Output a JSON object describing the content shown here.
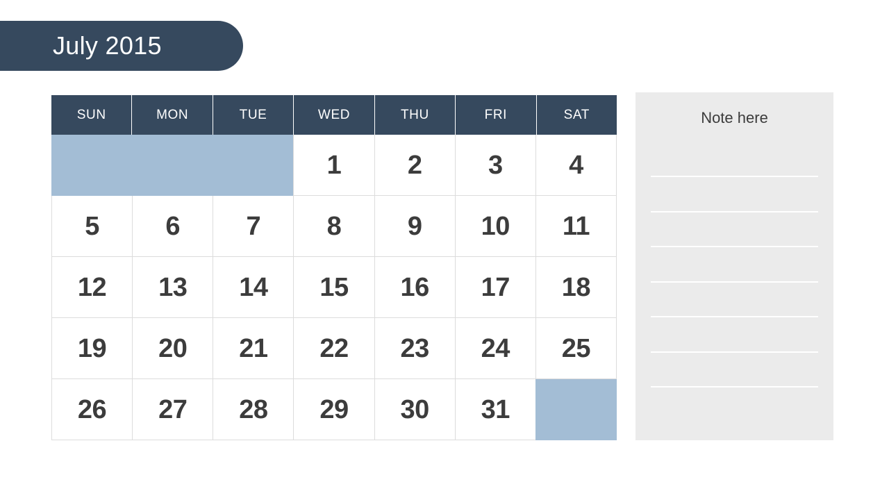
{
  "header": {
    "title": "July 2015"
  },
  "calendar": {
    "weekday_headers": [
      "SUN",
      "MON",
      "TUE",
      "WED",
      "THU",
      "FRI",
      "SAT"
    ],
    "weeks": [
      [
        {
          "label": "",
          "blank": true
        },
        {
          "label": "",
          "blank": true
        },
        {
          "label": "",
          "blank": true
        },
        {
          "label": "1",
          "blank": false
        },
        {
          "label": "2",
          "blank": false
        },
        {
          "label": "3",
          "blank": false
        },
        {
          "label": "4",
          "blank": false
        }
      ],
      [
        {
          "label": "5",
          "blank": false
        },
        {
          "label": "6",
          "blank": false
        },
        {
          "label": "7",
          "blank": false
        },
        {
          "label": "8",
          "blank": false
        },
        {
          "label": "9",
          "blank": false
        },
        {
          "label": "10",
          "blank": false
        },
        {
          "label": "11",
          "blank": false
        }
      ],
      [
        {
          "label": "12",
          "blank": false
        },
        {
          "label": "13",
          "blank": false
        },
        {
          "label": "14",
          "blank": false
        },
        {
          "label": "15",
          "blank": false
        },
        {
          "label": "16",
          "blank": false
        },
        {
          "label": "17",
          "blank": false
        },
        {
          "label": "18",
          "blank": false
        }
      ],
      [
        {
          "label": "19",
          "blank": false
        },
        {
          "label": "20",
          "blank": false
        },
        {
          "label": "21",
          "blank": false
        },
        {
          "label": "22",
          "blank": false
        },
        {
          "label": "23",
          "blank": false
        },
        {
          "label": "24",
          "blank": false
        },
        {
          "label": "25",
          "blank": false
        }
      ],
      [
        {
          "label": "26",
          "blank": false
        },
        {
          "label": "27",
          "blank": false
        },
        {
          "label": "28",
          "blank": false
        },
        {
          "label": "29",
          "blank": false
        },
        {
          "label": "30",
          "blank": false
        },
        {
          "label": "31",
          "blank": false
        },
        {
          "label": "",
          "blank": true
        }
      ]
    ]
  },
  "note_panel": {
    "title": "Note here",
    "line_count": 7
  },
  "colors": {
    "navy": "#36495e",
    "blank_day": "#a3bdd5",
    "cell_border": "#dcdcdc",
    "day_text": "#3c3c3c",
    "note_background": "#ebebeb",
    "note_rule": "#ffffff",
    "page_background": "#ffffff"
  }
}
